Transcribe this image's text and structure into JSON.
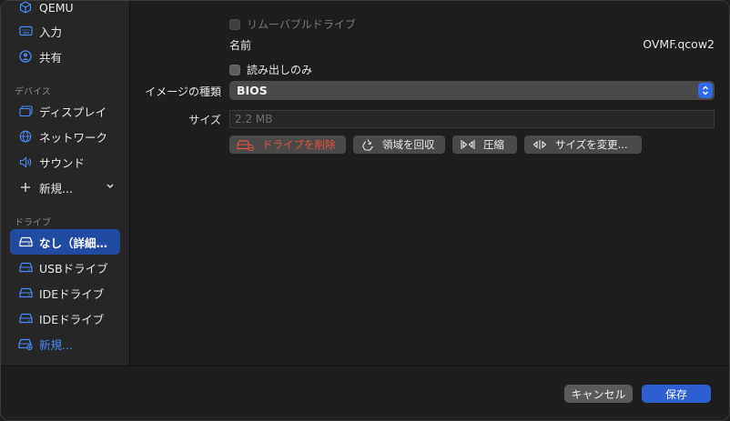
{
  "sidebar": {
    "top_items": [
      {
        "label": "QEMU",
        "icon": "cube-icon"
      },
      {
        "label": "入力",
        "icon": "keyboard-icon"
      },
      {
        "label": "共有",
        "icon": "person-circle-icon"
      }
    ],
    "devices_heading": "デバイス",
    "device_items": [
      {
        "label": "ディスプレイ",
        "icon": "display-icon"
      },
      {
        "label": "ネットワーク",
        "icon": "globe-icon"
      },
      {
        "label": "サウンド",
        "icon": "speaker-icon"
      },
      {
        "label": "新規...",
        "icon": "plus-icon"
      }
    ],
    "drives_heading": "ドライブ",
    "drive_items": [
      {
        "label": "なし（詳細…",
        "icon": "drive-icon",
        "selected": true
      },
      {
        "label": "USBドライブ",
        "icon": "drive-icon"
      },
      {
        "label": "IDEドライブ",
        "icon": "drive-icon"
      },
      {
        "label": "IDEドライブ",
        "icon": "drive-icon"
      },
      {
        "label": "新規...",
        "icon": "drive-plus-icon"
      }
    ]
  },
  "form": {
    "removable_label": "リムーバブルドライブ",
    "name_label": "名前",
    "name_value": "OVMF.qcow2",
    "readonly_label": "読み出しのみ",
    "image_type_label": "イメージの種類",
    "image_type_value": "BIOS",
    "size_label": "サイズ",
    "size_value": "2.2 MB"
  },
  "actions": {
    "delete_label": "ドライブを削除",
    "reclaim_label": "領域を回収",
    "compress_label": "圧縮",
    "resize_label": "サイズを変更..."
  },
  "footer": {
    "cancel_label": "キャンセル",
    "save_label": "保存"
  },
  "colors": {
    "accent": "#2d5fd1",
    "selected_bg": "#1f4ba0",
    "danger": "#e5533d",
    "link_blue": "#4a8cf7"
  }
}
